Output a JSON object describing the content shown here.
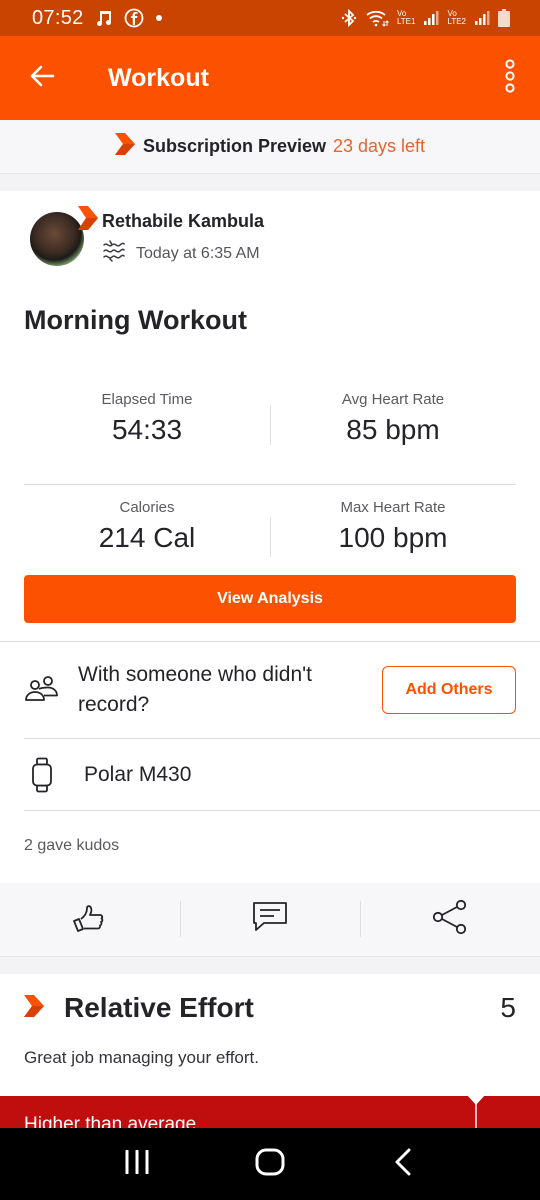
{
  "status_bar": {
    "time": "07:52",
    "left_icons": [
      "music-note-icon",
      "facebook-icon",
      "notification-dot-icon"
    ],
    "right_icons": [
      "bluetooth-icon",
      "wifi-icon",
      "signal-sim1-icon",
      "signal-sim2-icon",
      "battery-icon"
    ],
    "sim1_label_top": "Vo",
    "sim1_label_bottom": "LTE1",
    "sim2_label_top": "Vo",
    "sim2_label_bottom": "LTE2"
  },
  "app_bar": {
    "title": "Workout",
    "back_icon": "arrow-left-icon",
    "menu_icon": "more-vertical-icon"
  },
  "promo": {
    "icon": "strava-chevron-icon",
    "label": "Subscription Preview",
    "days_left": "23 days left"
  },
  "activity": {
    "athlete_name": "Rethabile Kambula",
    "activity_type_icon": "workout-waves-icon",
    "timestamp": "Today at 6:35 AM",
    "title": "Morning Workout",
    "stats": [
      {
        "label": "Elapsed Time",
        "value": "54:33"
      },
      {
        "label": "Avg Heart Rate",
        "value": "85 bpm"
      },
      {
        "label": "Calories",
        "value": "214 Cal"
      },
      {
        "label": "Max Heart Rate",
        "value": "100 bpm"
      }
    ],
    "view_analysis_label": "View Analysis",
    "with_others_text": "With someone who didn't record?",
    "add_others_label": "Add Others",
    "device_name": "Polar M430",
    "kudos_text": "2 gave kudos"
  },
  "actions": [
    {
      "name": "kudos",
      "icon": "thumbs-up-icon"
    },
    {
      "name": "comment",
      "icon": "comment-icon"
    },
    {
      "name": "share",
      "icon": "share-icon"
    }
  ],
  "relative_effort": {
    "title": "Relative Effort",
    "score": "5",
    "description": "Great job managing your effort.",
    "band_label": "Higher than average"
  },
  "colors": {
    "brand": "#fc5200",
    "status_bar": "#c94400",
    "effort_band": "#c00d0d"
  }
}
